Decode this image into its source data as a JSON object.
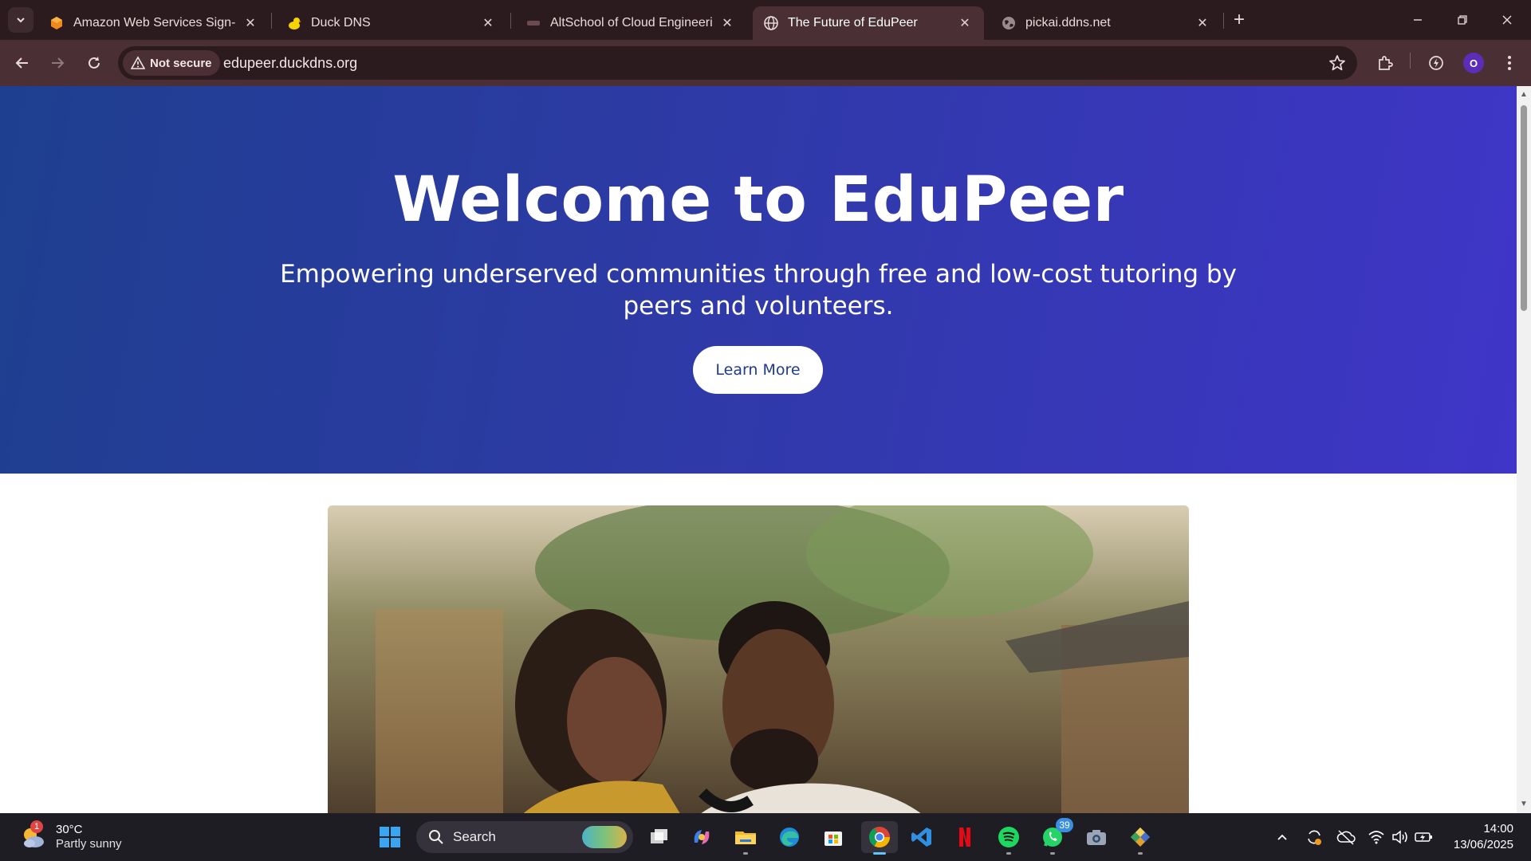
{
  "browser": {
    "tabs": [
      {
        "title": "Amazon Web Services Sign-In",
        "favicon": "aws-cube-icon",
        "active": false
      },
      {
        "title": "Duck DNS",
        "favicon": "duck-icon",
        "active": false
      },
      {
        "title": "AltSchool of Cloud Engineering",
        "favicon": "altschool-icon",
        "active": false
      },
      {
        "title": "The Future of EduPeer",
        "favicon": "globe-icon",
        "active": true
      },
      {
        "title": "pickai.ddns.net",
        "favicon": "globe-icon",
        "active": false
      }
    ],
    "security_label": "Not secure",
    "url": "edupeer.duckdns.org",
    "profile_initial": "O"
  },
  "page": {
    "hero_title": "Welcome to EduPeer",
    "hero_subtitle": "Empowering underserved communities through free and low-cost tutoring by peers and volunteers.",
    "cta_label": "Learn More"
  },
  "taskbar": {
    "weather": {
      "temp": "30°C",
      "description": "Partly sunny",
      "badge": "1"
    },
    "search_label": "Search",
    "whatsapp_badge": "39",
    "clock": {
      "time": "14:00",
      "date": "13/06/2025"
    }
  },
  "colors": {
    "hero_start": "#1e3f8f",
    "hero_end": "#3f35c8",
    "chrome_dark": "#2b1b1e",
    "chrome_toolbar": "#4a2f34"
  }
}
